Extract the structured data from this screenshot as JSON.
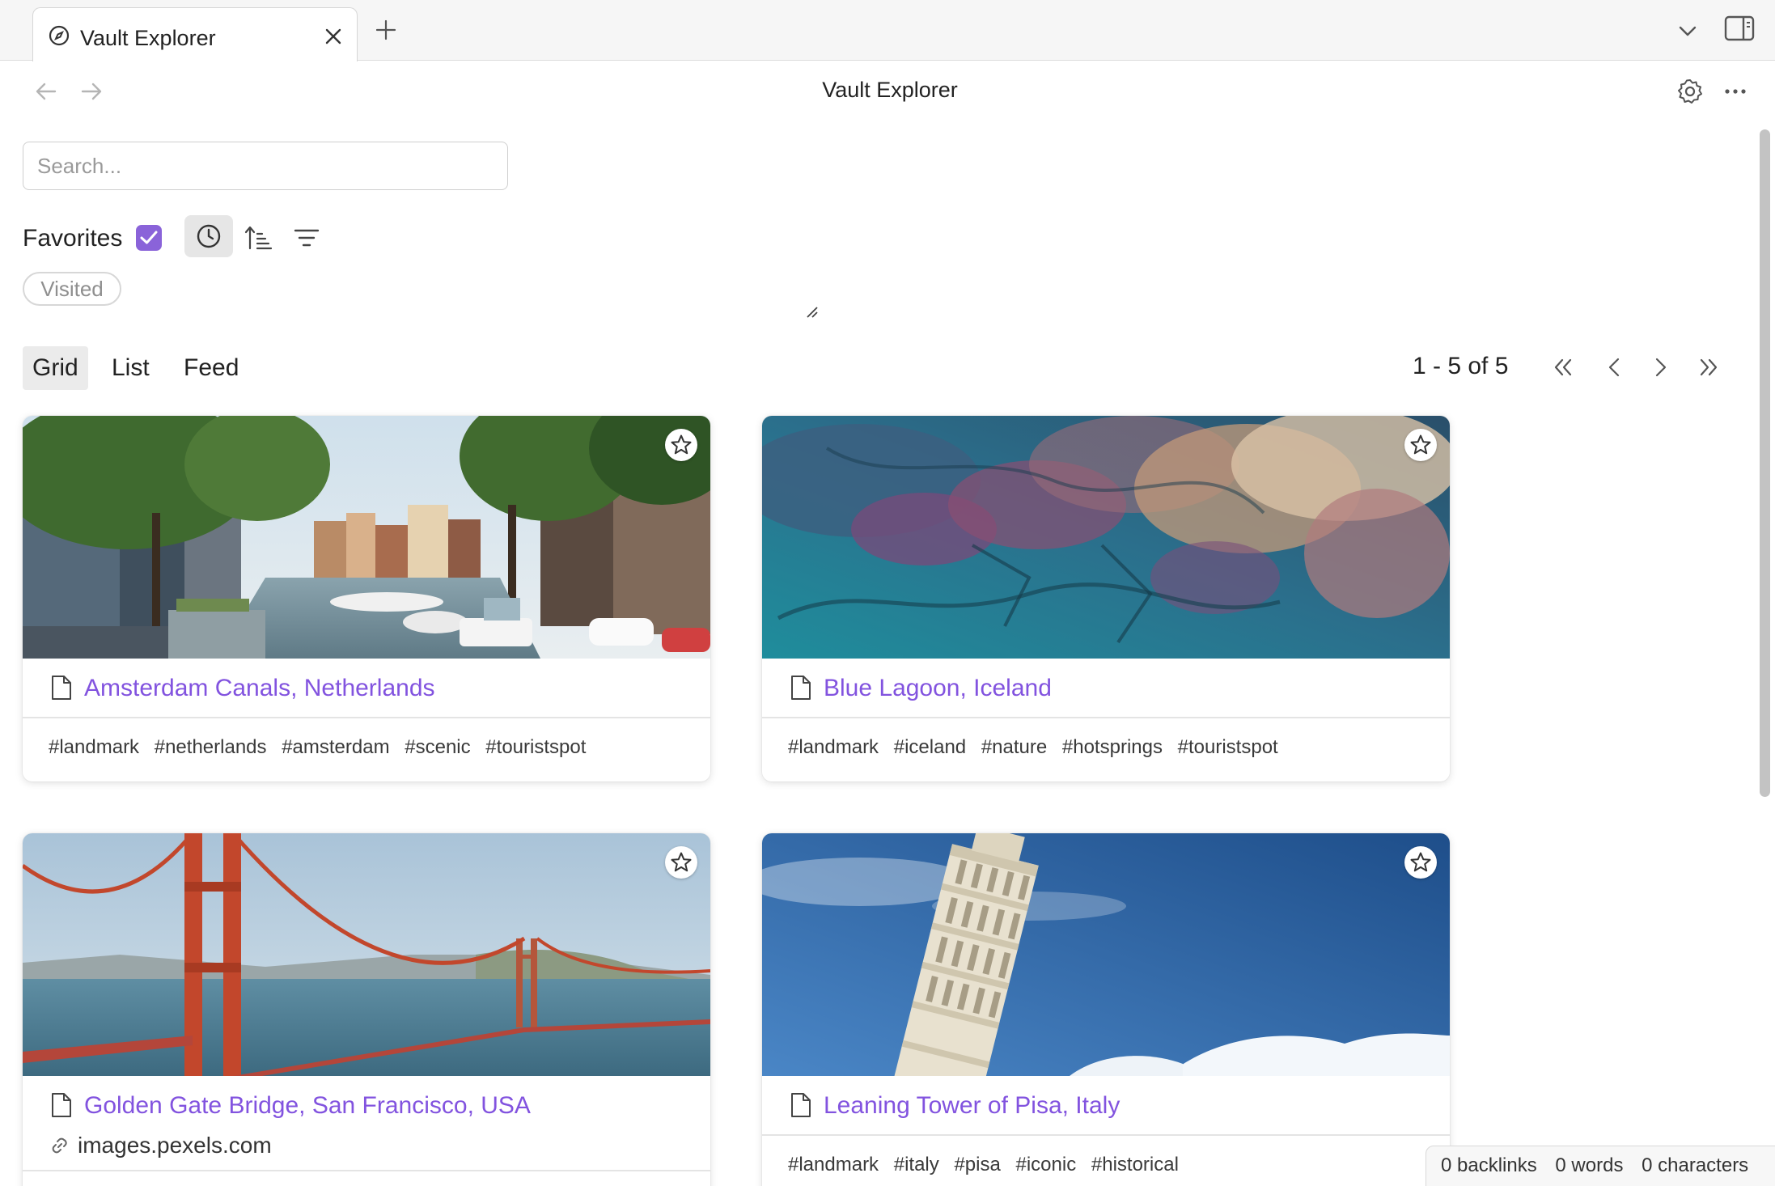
{
  "tab": {
    "title": "Vault Explorer"
  },
  "view": {
    "title": "Vault Explorer"
  },
  "search": {
    "placeholder": "Search...",
    "value": ""
  },
  "filters": {
    "favorites_label": "Favorites",
    "favorites_checked": true,
    "tag_chip": "Visited"
  },
  "view_modes": {
    "grid": "Grid",
    "list": "List",
    "feed": "Feed",
    "active": "Grid"
  },
  "pagination": {
    "text": "1 - 5 of 5"
  },
  "cards": [
    {
      "title": "Amsterdam Canals, Netherlands",
      "tags": [
        "#landmark",
        "#netherlands",
        "#amsterdam",
        "#scenic",
        "#touristspot"
      ],
      "image": "amsterdam-canal-photo"
    },
    {
      "title": "Blue Lagoon, Iceland",
      "tags": [
        "#landmark",
        "#iceland",
        "#nature",
        "#hotsprings",
        "#touristspot"
      ],
      "image": "blue-lagoon-aerial-photo"
    },
    {
      "title": "Golden Gate Bridge, San Francisco, USA",
      "url": "images.pexels.com",
      "image": "golden-gate-bridge-photo"
    },
    {
      "title": "Leaning Tower of Pisa, Italy",
      "tags": [
        "#landmark",
        "#italy",
        "#pisa",
        "#iconic",
        "#historical"
      ],
      "image": "leaning-tower-pisa-photo"
    }
  ],
  "status": {
    "backlinks": "0 backlinks",
    "words": "0 words",
    "characters": "0 characters"
  },
  "colors": {
    "accent": "#8a63d9",
    "link": "#8253df",
    "muted": "#9a9a9a"
  },
  "icons": [
    "compass-icon",
    "close-icon",
    "plus-icon",
    "chevron-down-icon",
    "sidebar-toggle-icon",
    "arrow-left-icon",
    "arrow-right-icon",
    "gear-icon",
    "more-horizontal-icon",
    "check-icon",
    "clock-icon",
    "sort-ascending-icon",
    "filter-icon",
    "chevrons-left-icon",
    "chevron-left-icon",
    "chevron-right-icon",
    "chevrons-right-icon",
    "star-icon",
    "file-icon",
    "link-icon"
  ]
}
